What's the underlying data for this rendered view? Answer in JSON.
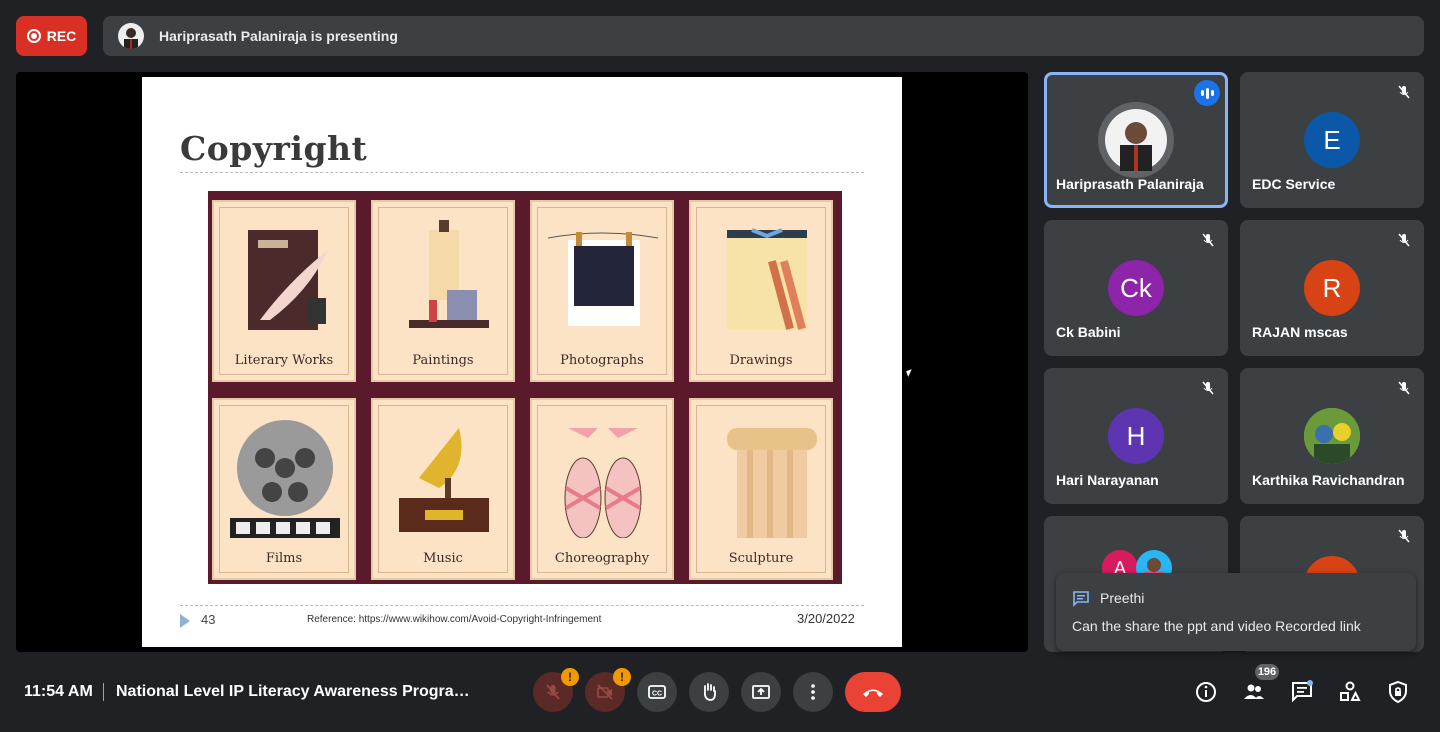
{
  "recording": {
    "label": "REC"
  },
  "presenter_banner": {
    "text": "Hariprasath Palaniraja is presenting"
  },
  "slide": {
    "title": "Copyright",
    "cards": [
      "Literary Works",
      "Paintings",
      "Photographs",
      "Drawings",
      "Films",
      "Music",
      "Choreography",
      "Sculpture"
    ],
    "page_number": "43",
    "reference": "Reference: https://www.wikihow.com/Avoid-Copyright-Infringement",
    "date": "3/20/2022"
  },
  "participants": [
    {
      "name": "Hariprasath Palaniraja",
      "initial": "",
      "color": "#5f6368",
      "speaking": true
    },
    {
      "name": "EDC Service",
      "initial": "E",
      "color": "#0b57a8",
      "speaking": false
    },
    {
      "name": "Ck Babini",
      "initial": "Ck",
      "color": "#8e24aa",
      "speaking": false
    },
    {
      "name": "RAJAN mscas",
      "initial": "R",
      "color": "#d84315",
      "speaking": false
    },
    {
      "name": "Hari Narayanan",
      "initial": "H",
      "color": "#5e35b1",
      "speaking": false
    },
    {
      "name": "Karthika Ravichandran",
      "initial": "",
      "color": "#7cb342",
      "speaking": false
    },
    {
      "name": "",
      "initial": "A",
      "color": "#d81b60",
      "speaking": false
    },
    {
      "name": "",
      "initial": "",
      "color": "#d84315",
      "speaking": false
    }
  ],
  "chat_popup": {
    "sender": "Preethi",
    "message": "Can the share the ppt and video  Recorded link"
  },
  "footer": {
    "time": "11:54 AM",
    "meeting_title": "National Level IP Literacy Awareness Program...",
    "participant_count": "196"
  }
}
